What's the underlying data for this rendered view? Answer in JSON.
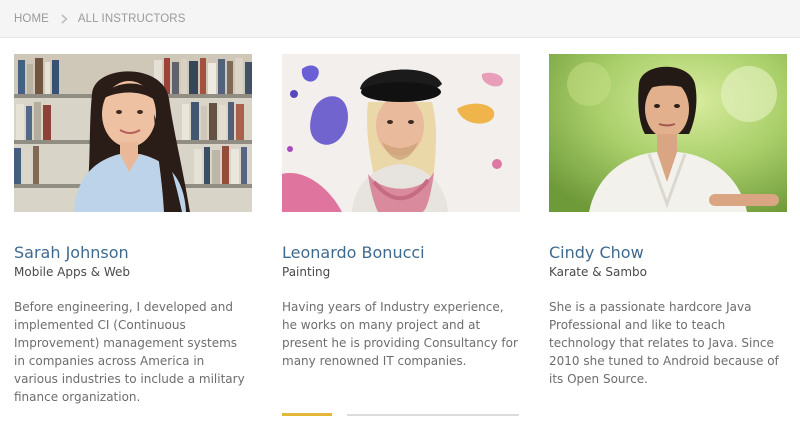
{
  "breadcrumb": {
    "home": "HOME",
    "current": "ALL INSTRUCTORS",
    "separator_icon": "chevron-right-icon"
  },
  "instructors": [
    {
      "name": "Sarah Johnson",
      "subject": "Mobile Apps & Web",
      "bio": "Before engineering, I developed and implemented CI (Continuous Improvement) management systems in companies across America in various industries to include a military finance organization."
    },
    {
      "name": "Leonardo Bonucci",
      "subject": "Painting",
      "bio": "Having years of Industry experience, he works on many project and at present he is providing Consultancy for many renowned IT companies."
    },
    {
      "name": "Cindy Chow",
      "subject": "Karate & Sambo",
      "bio": "She is a passionate hardcore Java Professional and like to teach technology that relates to Java. Since 2010 she tuned to Android because of its Open Source."
    }
  ],
  "colors": {
    "name_link": "#3f6a8f",
    "pager_active": "#e4b73a",
    "pager_track": "#dcdcdc",
    "breadcrumb_bg": "#f5f5f5"
  }
}
